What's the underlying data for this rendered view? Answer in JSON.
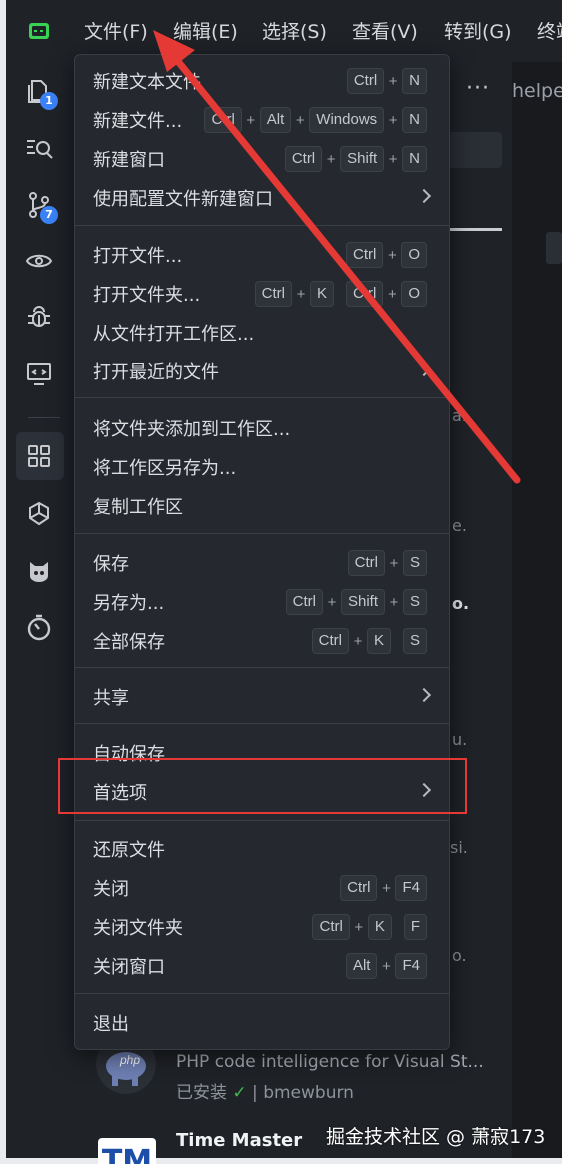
{
  "app": {
    "logo_icon": "terminal-app-logo-icon",
    "accent": "#39d353"
  },
  "menubar": {
    "items": [
      "文件(F)",
      "编辑(E)",
      "选择(S)",
      "查看(V)",
      "转到(G)",
      "终端"
    ]
  },
  "activity_bar": {
    "items": [
      {
        "icon": "explorer-icon",
        "badge": "1"
      },
      {
        "icon": "search-icon"
      },
      {
        "icon": "source-control-icon",
        "badge": "7"
      },
      {
        "icon": "eye-icon"
      },
      {
        "icon": "debug-bug-icon"
      },
      {
        "icon": "remote-monitor-icon"
      },
      {
        "icon": "extensions-grid-icon",
        "active": true
      },
      {
        "icon": "pinwheel-icon"
      },
      {
        "icon": "mascot-icon"
      },
      {
        "icon": "timer-icon"
      }
    ]
  },
  "background": {
    "more_actions": "···",
    "helper_tab": "helper",
    "fragments": [
      "a.",
      "e.",
      "o.",
      "u.",
      "si.",
      "o."
    ],
    "extensions": [
      {
        "description": "PHP code intelligence for Visual St...",
        "installed_label": "已安装",
        "check": "✓",
        "publisher": "bmewburn",
        "icon": "php-elephant-icon"
      },
      {
        "title": "Time Master",
        "icon_text": "TM"
      }
    ]
  },
  "file_menu": {
    "groups": [
      [
        {
          "label": "新建文本文件",
          "keys": [
            [
              "Ctrl",
              "N"
            ]
          ]
        },
        {
          "label": "新建文件...",
          "keys": [
            [
              "Ctrl",
              "Alt",
              "Windows",
              "N"
            ]
          ]
        },
        {
          "label": "新建窗口",
          "keys": [
            [
              "Ctrl",
              "Shift",
              "N"
            ]
          ]
        },
        {
          "label": "使用配置文件新建窗口",
          "submenu": true
        }
      ],
      [
        {
          "label": "打开文件...",
          "keys": [
            [
              "Ctrl",
              "O"
            ]
          ]
        },
        {
          "label": "打开文件夹...",
          "keys": [
            [
              "Ctrl",
              "K"
            ],
            [
              "Ctrl",
              "O"
            ]
          ]
        },
        {
          "label": "从文件打开工作区..."
        },
        {
          "label": "打开最近的文件",
          "submenu": true
        }
      ],
      [
        {
          "label": "将文件夹添加到工作区..."
        },
        {
          "label": "将工作区另存为..."
        },
        {
          "label": "复制工作区"
        }
      ],
      [
        {
          "label": "保存",
          "keys": [
            [
              "Ctrl",
              "S"
            ]
          ]
        },
        {
          "label": "另存为...",
          "keys": [
            [
              "Ctrl",
              "Shift",
              "S"
            ]
          ]
        },
        {
          "label": "全部保存",
          "keys": [
            [
              "Ctrl",
              "K"
            ],
            [
              "S"
            ]
          ]
        }
      ],
      [
        {
          "label": "共享",
          "submenu": true
        }
      ],
      [
        {
          "label": "自动保存"
        },
        {
          "label": "首选项",
          "submenu": true,
          "highlighted": true
        }
      ],
      [
        {
          "label": "还原文件"
        },
        {
          "label": "关闭",
          "keys": [
            [
              "Ctrl",
              "F4"
            ]
          ]
        },
        {
          "label": "关闭文件夹",
          "keys": [
            [
              "Ctrl",
              "K"
            ],
            [
              "F"
            ]
          ]
        },
        {
          "label": "关闭窗口",
          "keys": [
            [
              "Alt",
              "F4"
            ]
          ]
        }
      ],
      [
        {
          "label": "退出"
        }
      ]
    ]
  },
  "annotation": {
    "highlight_color": "#e53935",
    "arrow_color": "#e53935"
  },
  "watermark": "掘金技术社区 @ 萧寂173"
}
